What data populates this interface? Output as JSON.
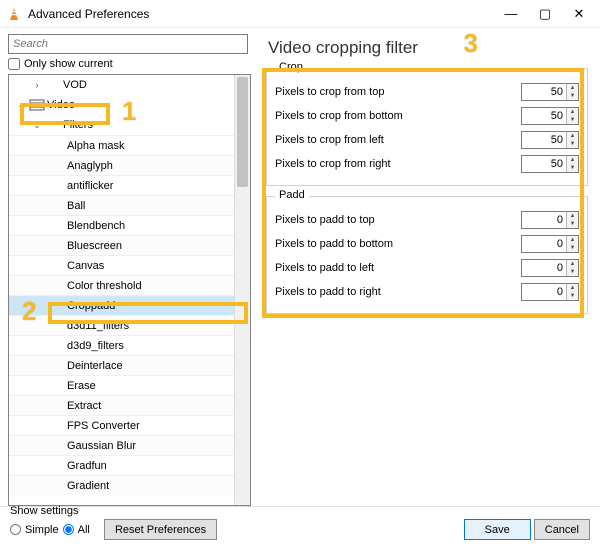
{
  "window": {
    "title": "Advanced Preferences",
    "minimize": "—",
    "maximize": "▢",
    "close": "✕"
  },
  "left": {
    "search_placeholder": "Search",
    "only_show_current": "Only show current",
    "tree": {
      "vod": "VOD",
      "video": "Video",
      "filters": "Filters",
      "items": [
        "Alpha mask",
        "Anaglyph",
        "antiflicker",
        "Ball",
        "Blendbench",
        "Bluescreen",
        "Canvas",
        "Color threshold",
        "Croppadd",
        "d3d11_filters",
        "d3d9_filters",
        "Deinterlace",
        "Erase",
        "Extract",
        "FPS Converter",
        "Gaussian Blur",
        "Gradfun",
        "Gradient"
      ],
      "selected_index": 8
    }
  },
  "right": {
    "title": "Video cropping filter",
    "crop": {
      "legend": "Crop",
      "rows": [
        {
          "label": "Pixels to crop from top",
          "value": 50
        },
        {
          "label": "Pixels to crop from bottom",
          "value": 50
        },
        {
          "label": "Pixels to crop from left",
          "value": 50
        },
        {
          "label": "Pixels to crop from right",
          "value": 50
        }
      ]
    },
    "padd": {
      "legend": "Padd",
      "rows": [
        {
          "label": "Pixels to padd to top",
          "value": 0
        },
        {
          "label": "Pixels to padd to bottom",
          "value": 0
        },
        {
          "label": "Pixels to padd to left",
          "value": 0
        },
        {
          "label": "Pixels to padd to right",
          "value": 0
        }
      ]
    }
  },
  "footer": {
    "show_settings": "Show settings",
    "simple": "Simple",
    "all": "All",
    "reset": "Reset Preferences",
    "save": "Save",
    "cancel": "Cancel"
  },
  "annotations": {
    "one": "1",
    "two": "2",
    "three": "3"
  }
}
